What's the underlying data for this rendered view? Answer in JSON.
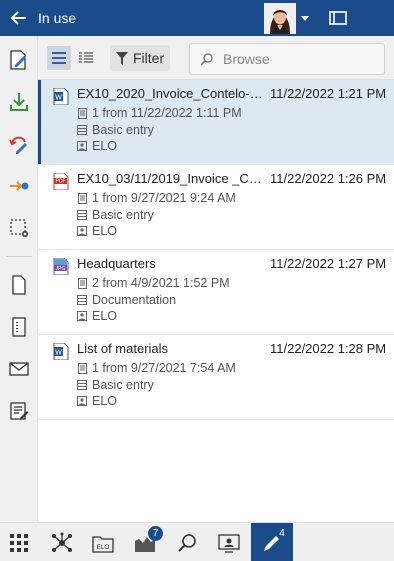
{
  "header": {
    "title": "In use",
    "back_icon": "arrow-left-icon",
    "window_icon": "window-icon"
  },
  "colors": {
    "primary": "#1a4c8b",
    "selected_bg": "#dde8f1",
    "toolbar_bg": "#f0f0f0"
  },
  "toolbar": {
    "filter_label": "Filter",
    "search_placeholder": "Browse"
  },
  "left_toolbar": [
    "edit-document-icon",
    "download-icon",
    "undo-checkout-icon",
    "assign-icon",
    "selection-settings-icon",
    "new-document-icon",
    "barcode-document-icon",
    "email-icon",
    "form-icon"
  ],
  "items": [
    {
      "title": "EX10_2020_Invoice_Contelo-Co...",
      "date": "11/22/2022 1:21 PM",
      "version": "1 from 11/22/2022 1:11 PM",
      "mask": "Basic entry",
      "owner": "ELO",
      "file_type": "W"
    },
    {
      "title": "EX10_03/11/2019_Invoice _Cont...",
      "date": "11/22/2022 1:26 PM",
      "version": "1 from 9/27/2021 9:24 AM",
      "mask": "Basic entry",
      "owner": "ELO",
      "file_type": "PDF"
    },
    {
      "title": "Headquarters",
      "date": "11/22/2022 1:27 PM",
      "version": "2 from 4/9/2021 1:52 PM",
      "mask": "Documentation",
      "owner": "ELO",
      "file_type": "JPG"
    },
    {
      "title": "List of materials",
      "date": "11/22/2022 1:28 PM",
      "version": "1 from 9/27/2021 7:54 AM",
      "mask": "Basic entry",
      "owner": "ELO",
      "file_type": "W"
    }
  ],
  "bottom_bar": {
    "tasks_badge": "7",
    "in_use_badge": "4",
    "elo_label": "ELO"
  }
}
